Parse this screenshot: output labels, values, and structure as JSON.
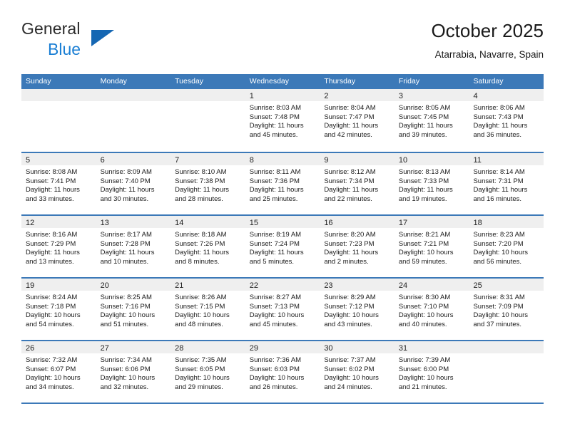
{
  "brand": {
    "name_part1": "General",
    "name_part2": "Blue",
    "logo_icon": "triangle-logo-icon",
    "color_dark": "#2b2b2b",
    "color_blue": "#1b7fd4"
  },
  "header": {
    "title": "October 2025",
    "subtitle": "Atarrabia, Navarre, Spain"
  },
  "theme": {
    "header_blue": "#3c79b8",
    "daynum_band_gray": "#efefef",
    "text": "#1a1a1a"
  },
  "calendar": {
    "weekday_headers": [
      "Sunday",
      "Monday",
      "Tuesday",
      "Wednesday",
      "Thursday",
      "Friday",
      "Saturday"
    ],
    "weeks": [
      [
        {
          "day": "",
          "sunrise": "",
          "sunset": "",
          "daylight": "",
          "empty": true
        },
        {
          "day": "",
          "sunrise": "",
          "sunset": "",
          "daylight": "",
          "empty": true
        },
        {
          "day": "",
          "sunrise": "",
          "sunset": "",
          "daylight": "",
          "empty": true
        },
        {
          "day": "1",
          "sunrise": "Sunrise: 8:03 AM",
          "sunset": "Sunset: 7:48 PM",
          "daylight": "Daylight: 11 hours and 45 minutes."
        },
        {
          "day": "2",
          "sunrise": "Sunrise: 8:04 AM",
          "sunset": "Sunset: 7:47 PM",
          "daylight": "Daylight: 11 hours and 42 minutes."
        },
        {
          "day": "3",
          "sunrise": "Sunrise: 8:05 AM",
          "sunset": "Sunset: 7:45 PM",
          "daylight": "Daylight: 11 hours and 39 minutes."
        },
        {
          "day": "4",
          "sunrise": "Sunrise: 8:06 AM",
          "sunset": "Sunset: 7:43 PM",
          "daylight": "Daylight: 11 hours and 36 minutes."
        }
      ],
      [
        {
          "day": "5",
          "sunrise": "Sunrise: 8:08 AM",
          "sunset": "Sunset: 7:41 PM",
          "daylight": "Daylight: 11 hours and 33 minutes."
        },
        {
          "day": "6",
          "sunrise": "Sunrise: 8:09 AM",
          "sunset": "Sunset: 7:40 PM",
          "daylight": "Daylight: 11 hours and 30 minutes."
        },
        {
          "day": "7",
          "sunrise": "Sunrise: 8:10 AM",
          "sunset": "Sunset: 7:38 PM",
          "daylight": "Daylight: 11 hours and 28 minutes."
        },
        {
          "day": "8",
          "sunrise": "Sunrise: 8:11 AM",
          "sunset": "Sunset: 7:36 PM",
          "daylight": "Daylight: 11 hours and 25 minutes."
        },
        {
          "day": "9",
          "sunrise": "Sunrise: 8:12 AM",
          "sunset": "Sunset: 7:34 PM",
          "daylight": "Daylight: 11 hours and 22 minutes."
        },
        {
          "day": "10",
          "sunrise": "Sunrise: 8:13 AM",
          "sunset": "Sunset: 7:33 PM",
          "daylight": "Daylight: 11 hours and 19 minutes."
        },
        {
          "day": "11",
          "sunrise": "Sunrise: 8:14 AM",
          "sunset": "Sunset: 7:31 PM",
          "daylight": "Daylight: 11 hours and 16 minutes."
        }
      ],
      [
        {
          "day": "12",
          "sunrise": "Sunrise: 8:16 AM",
          "sunset": "Sunset: 7:29 PM",
          "daylight": "Daylight: 11 hours and 13 minutes."
        },
        {
          "day": "13",
          "sunrise": "Sunrise: 8:17 AM",
          "sunset": "Sunset: 7:28 PM",
          "daylight": "Daylight: 11 hours and 10 minutes."
        },
        {
          "day": "14",
          "sunrise": "Sunrise: 8:18 AM",
          "sunset": "Sunset: 7:26 PM",
          "daylight": "Daylight: 11 hours and 8 minutes."
        },
        {
          "day": "15",
          "sunrise": "Sunrise: 8:19 AM",
          "sunset": "Sunset: 7:24 PM",
          "daylight": "Daylight: 11 hours and 5 minutes."
        },
        {
          "day": "16",
          "sunrise": "Sunrise: 8:20 AM",
          "sunset": "Sunset: 7:23 PM",
          "daylight": "Daylight: 11 hours and 2 minutes."
        },
        {
          "day": "17",
          "sunrise": "Sunrise: 8:21 AM",
          "sunset": "Sunset: 7:21 PM",
          "daylight": "Daylight: 10 hours and 59 minutes."
        },
        {
          "day": "18",
          "sunrise": "Sunrise: 8:23 AM",
          "sunset": "Sunset: 7:20 PM",
          "daylight": "Daylight: 10 hours and 56 minutes."
        }
      ],
      [
        {
          "day": "19",
          "sunrise": "Sunrise: 8:24 AM",
          "sunset": "Sunset: 7:18 PM",
          "daylight": "Daylight: 10 hours and 54 minutes."
        },
        {
          "day": "20",
          "sunrise": "Sunrise: 8:25 AM",
          "sunset": "Sunset: 7:16 PM",
          "daylight": "Daylight: 10 hours and 51 minutes."
        },
        {
          "day": "21",
          "sunrise": "Sunrise: 8:26 AM",
          "sunset": "Sunset: 7:15 PM",
          "daylight": "Daylight: 10 hours and 48 minutes."
        },
        {
          "day": "22",
          "sunrise": "Sunrise: 8:27 AM",
          "sunset": "Sunset: 7:13 PM",
          "daylight": "Daylight: 10 hours and 45 minutes."
        },
        {
          "day": "23",
          "sunrise": "Sunrise: 8:29 AM",
          "sunset": "Sunset: 7:12 PM",
          "daylight": "Daylight: 10 hours and 43 minutes."
        },
        {
          "day": "24",
          "sunrise": "Sunrise: 8:30 AM",
          "sunset": "Sunset: 7:10 PM",
          "daylight": "Daylight: 10 hours and 40 minutes."
        },
        {
          "day": "25",
          "sunrise": "Sunrise: 8:31 AM",
          "sunset": "Sunset: 7:09 PM",
          "daylight": "Daylight: 10 hours and 37 minutes."
        }
      ],
      [
        {
          "day": "26",
          "sunrise": "Sunrise: 7:32 AM",
          "sunset": "Sunset: 6:07 PM",
          "daylight": "Daylight: 10 hours and 34 minutes."
        },
        {
          "day": "27",
          "sunrise": "Sunrise: 7:34 AM",
          "sunset": "Sunset: 6:06 PM",
          "daylight": "Daylight: 10 hours and 32 minutes."
        },
        {
          "day": "28",
          "sunrise": "Sunrise: 7:35 AM",
          "sunset": "Sunset: 6:05 PM",
          "daylight": "Daylight: 10 hours and 29 minutes."
        },
        {
          "day": "29",
          "sunrise": "Sunrise: 7:36 AM",
          "sunset": "Sunset: 6:03 PM",
          "daylight": "Daylight: 10 hours and 26 minutes."
        },
        {
          "day": "30",
          "sunrise": "Sunrise: 7:37 AM",
          "sunset": "Sunset: 6:02 PM",
          "daylight": "Daylight: 10 hours and 24 minutes."
        },
        {
          "day": "31",
          "sunrise": "Sunrise: 7:39 AM",
          "sunset": "Sunset: 6:00 PM",
          "daylight": "Daylight: 10 hours and 21 minutes."
        },
        {
          "day": "",
          "sunrise": "",
          "sunset": "",
          "daylight": "",
          "empty": true
        }
      ]
    ]
  }
}
